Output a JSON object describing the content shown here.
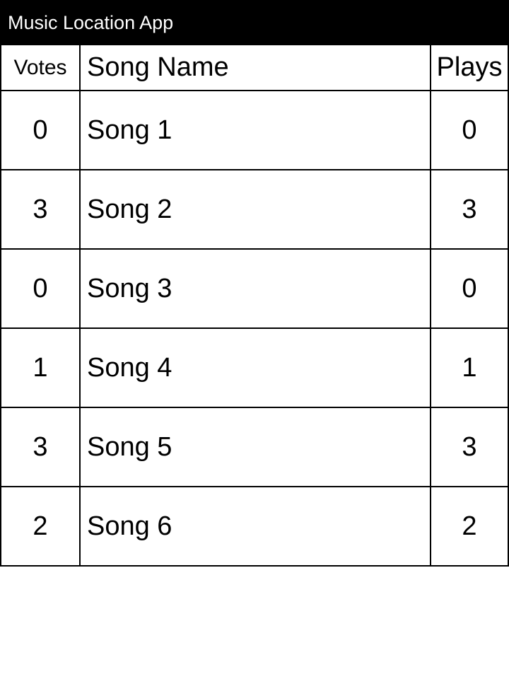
{
  "app": {
    "title": "Music Location App"
  },
  "table": {
    "headers": {
      "votes": "Votes",
      "song_name": "Song Name",
      "plays": "Plays"
    },
    "rows": [
      {
        "votes": "0",
        "song": "Song 1",
        "plays": "0"
      },
      {
        "votes": "3",
        "song": "Song 2",
        "plays": "3"
      },
      {
        "votes": "0",
        "song": "Song 3",
        "plays": "0"
      },
      {
        "votes": "1",
        "song": "Song 4",
        "plays": "1"
      },
      {
        "votes": "3",
        "song": "Song 5",
        "plays": "3"
      },
      {
        "votes": "2",
        "song": "Song 6",
        "plays": "2"
      }
    ]
  },
  "colors": {
    "titlebar_bg": "#000000",
    "titlebar_text": "#ffffff",
    "grid_line": "#000000",
    "background": "#ffffff"
  }
}
